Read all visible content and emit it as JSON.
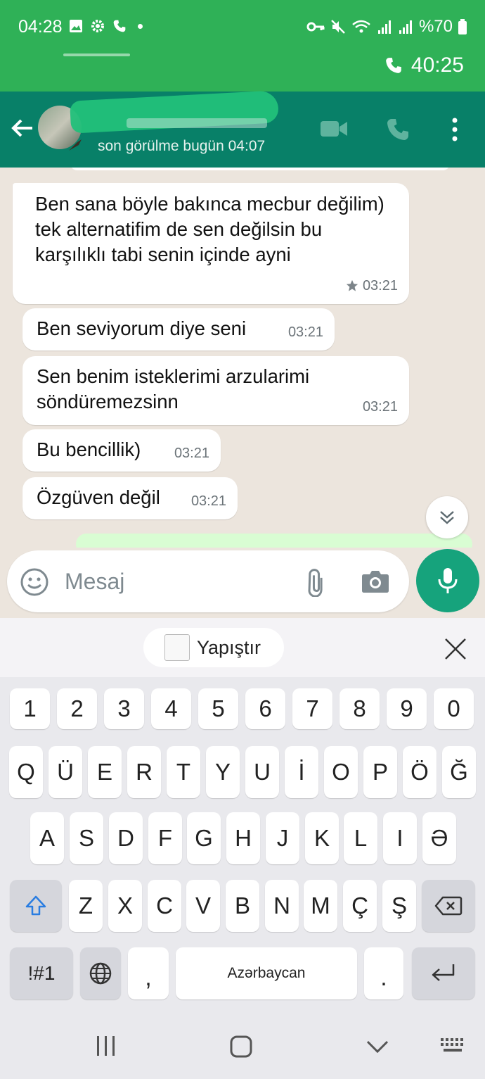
{
  "status_bar": {
    "time": "04:28",
    "battery": "%70",
    "call_timer": "40:25"
  },
  "header": {
    "last_seen": "son görülme bugün 04:07"
  },
  "messages": [
    {
      "text": "Ben sana böyle bakınca mecbur değilim) tek alternatifim de sen değilsin bu karşılıklı tabi senin içinde ayni",
      "time": "03:21",
      "starred": true
    },
    {
      "text": "Ben seviyorum diye seni",
      "time": "03:21",
      "starred": false
    },
    {
      "text": "Sen benim isteklerimi arzularimi söndüremezsinn",
      "time": "03:21",
      "starred": false
    },
    {
      "text": "Bu bencillik)",
      "time": "03:21",
      "starred": false
    },
    {
      "text": "Özgüven değil",
      "time": "03:21",
      "starred": false
    }
  ],
  "composer": {
    "placeholder": "Mesaj"
  },
  "keyboard": {
    "paste_label": "Yapıştır",
    "space_label": "Azərbaycan",
    "symbols_label": "!#1",
    "row_numbers": [
      "1",
      "2",
      "3",
      "4",
      "5",
      "6",
      "7",
      "8",
      "9",
      "0"
    ],
    "row1": [
      "Q",
      "Ü",
      "E",
      "R",
      "T",
      "Y",
      "U",
      "İ",
      "O",
      "P",
      "Ö",
      "Ğ"
    ],
    "row2": [
      "A",
      "S",
      "D",
      "F",
      "G",
      "H",
      "J",
      "K",
      "L",
      "I",
      "Ə"
    ],
    "row3": [
      "Z",
      "X",
      "C",
      "V",
      "B",
      "N",
      "M",
      "Ç",
      "Ş"
    ],
    "comma": ",",
    "period": "."
  },
  "colors": {
    "status_green": "#2fb157",
    "header_teal": "#088068",
    "mic_green": "#16a37c",
    "chat_bg": "#ece5dd"
  }
}
